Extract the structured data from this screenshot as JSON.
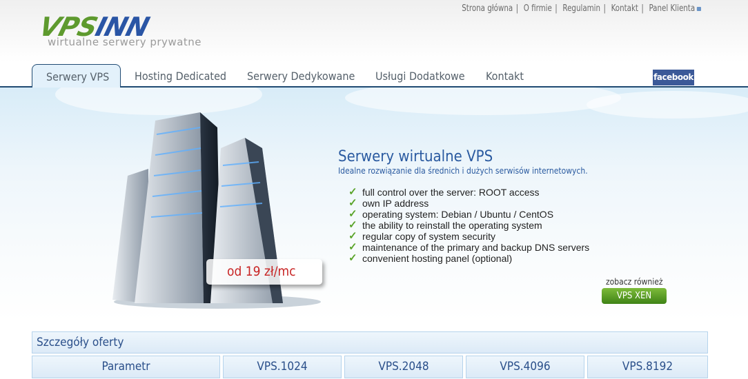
{
  "top_links": [
    "Strona główna",
    "O firmie",
    "Regulamin",
    "Kontakt",
    "Panel Klienta"
  ],
  "logo": {
    "part1": "VPS",
    "part2": "INN",
    "tagline": "wirtualne serwery prywatne"
  },
  "nav": {
    "tabs": [
      {
        "label": "Serwery VPS",
        "active": true
      },
      {
        "label": "Hosting Dedicated"
      },
      {
        "label": "Serwery Dedykowane"
      },
      {
        "label": "Usługi Dodatkowe"
      },
      {
        "label": "Kontakt"
      }
    ],
    "facebook": "facebook"
  },
  "hero": {
    "title": "Serwery wirtualne VPS",
    "subtitle": "Idealne rozwiązanie dla średnich i dużych serwisów internetowych.",
    "features": [
      "full control over the server: ROOT access",
      "own IP address",
      "operating system: Debian / Ubuntu / CentOS",
      "the ability to reinstall the operating system",
      "regular copy of system security",
      "maintenance of the primary and backup DNS servers",
      "convenient hosting panel (optional)"
    ],
    "price": "od 19 zł/mc",
    "see_also": "zobacz również",
    "xen_button": "VPS XEN"
  },
  "offer": {
    "title": "Szczegóły oferty",
    "columns": [
      "Parametr",
      "VPS.1024",
      "VPS.2048",
      "VPS.4096",
      "VPS.8192"
    ]
  },
  "colors": {
    "accent": "#2a5aa0",
    "green": "#5e9a2e",
    "price": "#c82424"
  }
}
